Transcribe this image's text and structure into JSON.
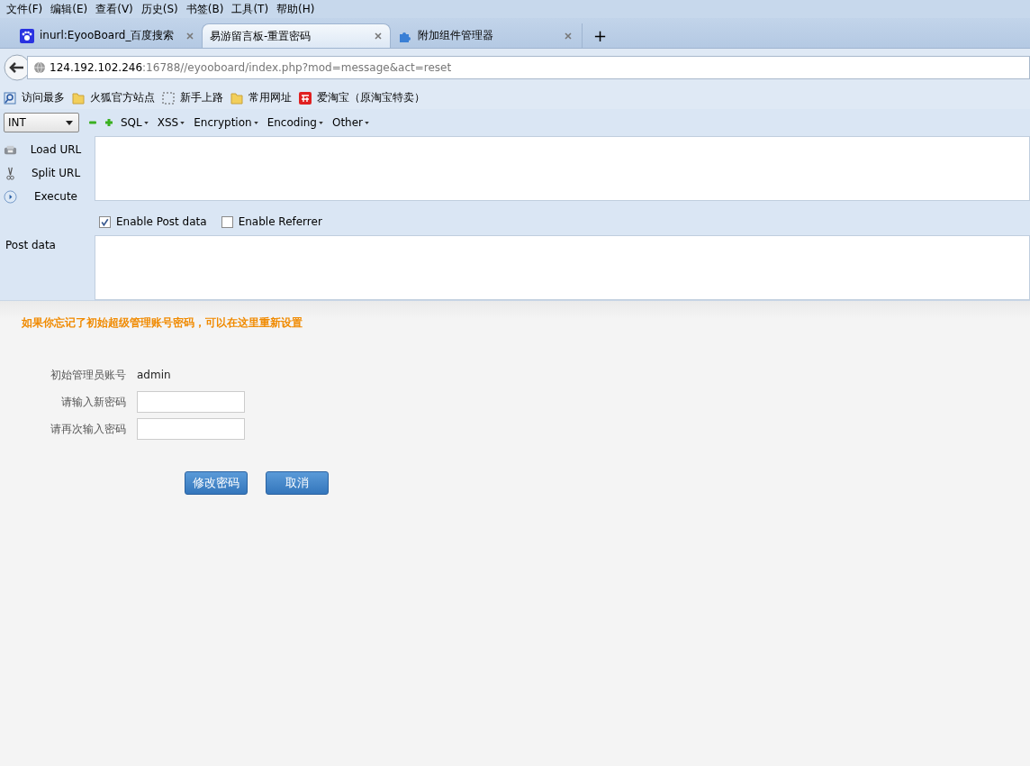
{
  "menu": [
    "文件(F)",
    "编辑(E)",
    "查看(V)",
    "历史(S)",
    "书签(B)",
    "工具(T)",
    "帮助(H)"
  ],
  "tabs": [
    {
      "label": "inurl:EyooBoard_百度搜索",
      "selected": false,
      "kind": "paw"
    },
    {
      "label": "易游留言板-重置密码",
      "selected": true,
      "kind": "none"
    },
    {
      "label": "附加组件管理器",
      "selected": false,
      "kind": "puzzle"
    }
  ],
  "new_tab": "+",
  "url": {
    "host": "124.192.102.246",
    "path": ":16788//eyooboard/index.php?mod=message&act=reset"
  },
  "bookmarks": [
    {
      "label": "访问最多",
      "kind": "search"
    },
    {
      "label": "火狐官方站点",
      "kind": "folder"
    },
    {
      "label": "新手上路",
      "kind": "dashed"
    },
    {
      "label": "常用网址",
      "kind": "folder"
    },
    {
      "label": "爱淘宝（原淘宝特卖）",
      "kind": "tao"
    }
  ],
  "hackbar": {
    "select": "INT",
    "menus": [
      "SQL",
      "XSS",
      "Encryption",
      "Encoding",
      "Other"
    ],
    "actions": [
      {
        "label": "Load URL",
        "kind": "load"
      },
      {
        "label": "Split URL",
        "kind": "split"
      },
      {
        "label": "Execute",
        "kind": "execute"
      }
    ],
    "options": [
      {
        "label": "Enable Post data",
        "checked": true
      },
      {
        "label": "Enable Referrer",
        "checked": false
      }
    ],
    "post_label": "Post data"
  },
  "page": {
    "notice": "如果你忘记了初始超级管理账号密码，可以在这里重新设置",
    "account_label": "初始管理员账号",
    "account_value": "admin",
    "fields": [
      {
        "label": "请输入新密码"
      },
      {
        "label": "请再次输入密码"
      }
    ],
    "buttons": [
      "修改密码",
      "取消"
    ]
  }
}
